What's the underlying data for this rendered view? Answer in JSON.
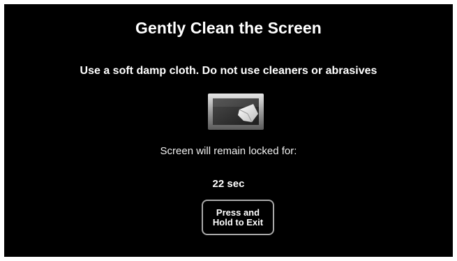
{
  "title": "Gently Clean the Screen",
  "instruction": "Use a soft damp cloth. Do not use cleaners or abrasives",
  "icon": "screen-cleaning-cloth-icon",
  "lock_message": "Screen will remain locked for:",
  "countdown": "22 sec",
  "exit_button": {
    "line1": "Press and",
    "line2": "Hold to Exit"
  },
  "colors": {
    "background": "#000000",
    "text": "#ffffff",
    "button_border": "#a9a9a9"
  }
}
